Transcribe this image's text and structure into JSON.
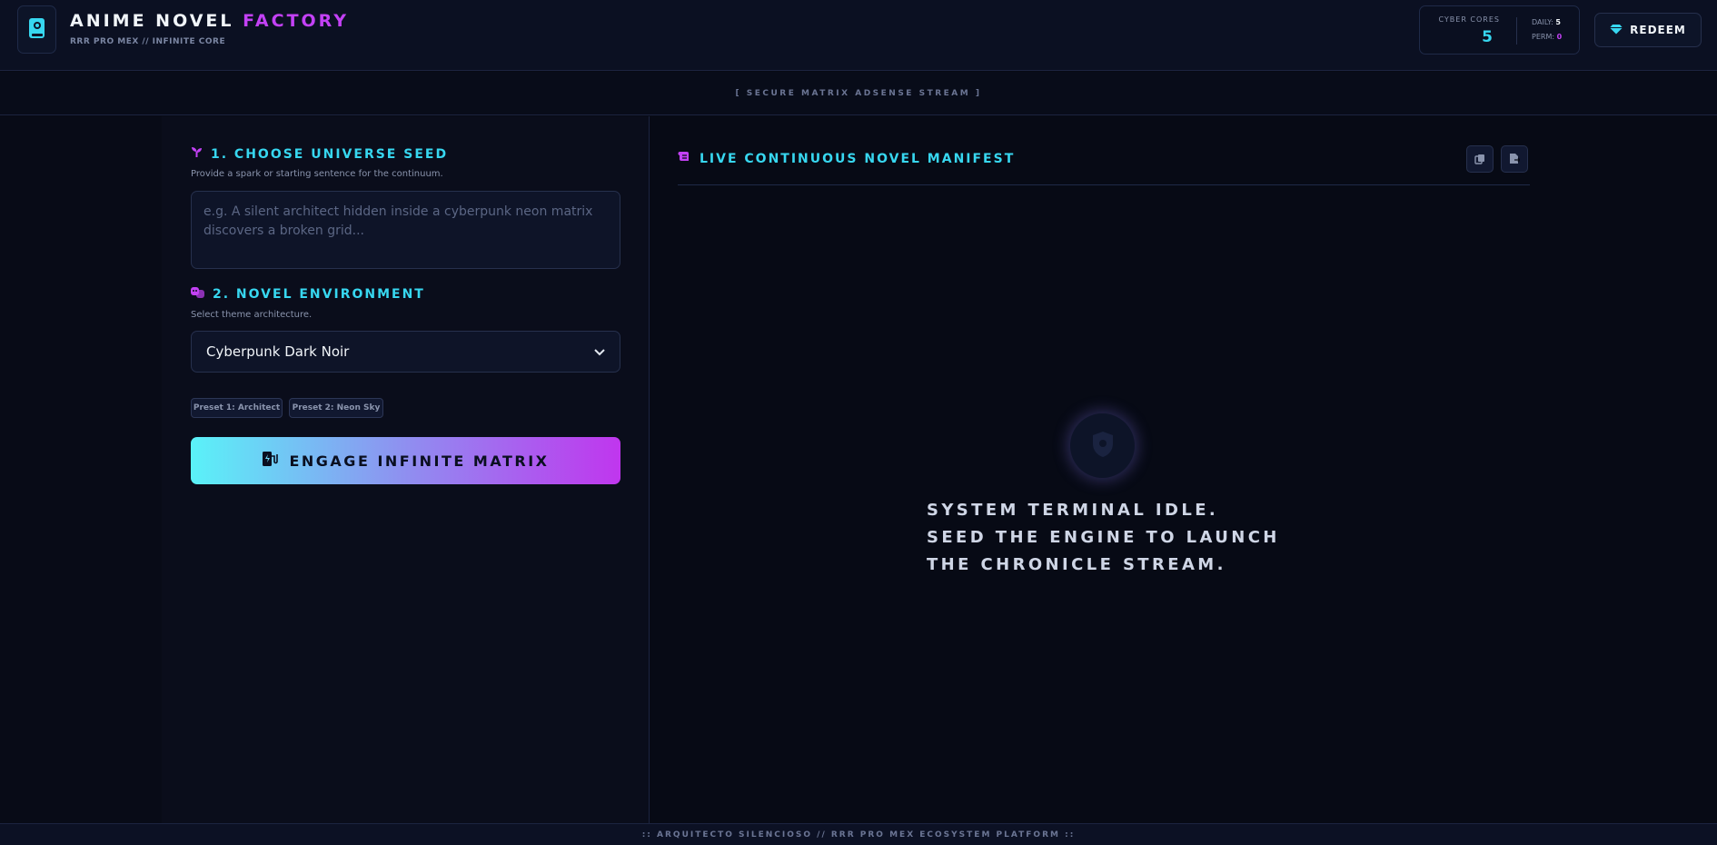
{
  "header": {
    "title_main": "ANIME NOVEL ",
    "title_accent": "FACTORY",
    "subtitle": "RRR PRO MEX // INFINITE CORE",
    "cores_label": "CYBER CORES",
    "cores_value": "5",
    "daily_label": "DAILY:",
    "daily_value": "5",
    "perm_label": "PERM:",
    "perm_value": "0",
    "redeem_label": "REDEEM"
  },
  "ad_stream": "[ SECURE MATRIX ADSENSE STREAM ]",
  "seed": {
    "title": "1. CHOOSE UNIVERSE SEED",
    "description": "Provide a spark or starting sentence for the continuum.",
    "placeholder": "e.g. A silent architect hidden inside a cyberpunk neon matrix discovers a broken grid...",
    "value": ""
  },
  "environment": {
    "title": "2. NOVEL ENVIRONMENT",
    "description": "Select theme architecture.",
    "selected": "Cyberpunk Dark Noir"
  },
  "presets": [
    "Preset 1: Architect",
    "Preset 2: Neon Sky"
  ],
  "engage_label": "ENGAGE INFINITE MATRIX",
  "manifest": {
    "title": "LIVE CONTINUOUS NOVEL MANIFEST",
    "idle_line1": "SYSTEM TERMINAL IDLE.",
    "idle_line2": "SEED THE ENGINE TO LAUNCH",
    "idle_line3": "THE CHRONICLE STREAM."
  },
  "footer": ":: ARQUITECTO SILENCIOSO // RRR PRO MEX ECOSYSTEM PLATFORM ::",
  "icons": {
    "logo": "book-icon",
    "redeem": "gem-icon",
    "seed": "sprout-icon",
    "environment": "masks-icon",
    "engage": "charging-station-icon",
    "manifest": "scroll-icon",
    "copy": "copy-icon",
    "export": "file-export-icon",
    "idle": "shield-icon"
  },
  "colors": {
    "accent_cyan": "#37d7f0",
    "accent_purple": "#c341f5",
    "background": "#070a15"
  }
}
